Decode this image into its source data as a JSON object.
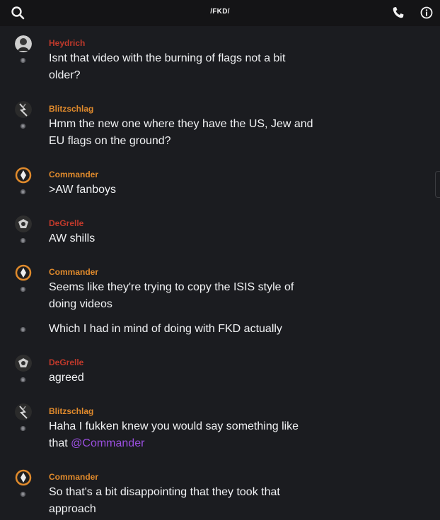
{
  "header": {
    "title": "/FKD/"
  },
  "messages": [
    {
      "author": "Heydrich",
      "lines": [
        "Isnt that video with the burning of flags not a bit",
        "older?"
      ]
    },
    {
      "author": "Blitzschlag",
      "lines": [
        "Hmm the new one where they have the US, Jew and",
        "EU flags on the ground?"
      ]
    },
    {
      "author": "Commander",
      "lines": [
        ">AW fanboys"
      ]
    },
    {
      "author": "DeGrelle",
      "lines": [
        "AW shills"
      ]
    },
    {
      "author": "Commander",
      "lines": [
        "Seems like they're trying to copy the ISIS style of",
        "doing videos"
      ]
    },
    {
      "continuation": "Which I had in mind of doing with FKD actually"
    },
    {
      "author": "DeGrelle",
      "lines": [
        "agreed"
      ]
    },
    {
      "author": "Blitzschlag",
      "lines": [
        "Haha I fukken knew you would say something like"
      ],
      "line2_prefix": "that ",
      "mention": "@Commander"
    },
    {
      "author": "Commander",
      "lines": [
        "So that's a bit disappointing that they took that",
        "approach"
      ]
    }
  ],
  "colors": {
    "accent_red": "#c0392b",
    "accent_orange": "#e08a2c",
    "mention": "#9b4fe0",
    "background": "#1b1c20"
  },
  "icons": [
    "search-icon",
    "phone-icon",
    "info-icon"
  ]
}
